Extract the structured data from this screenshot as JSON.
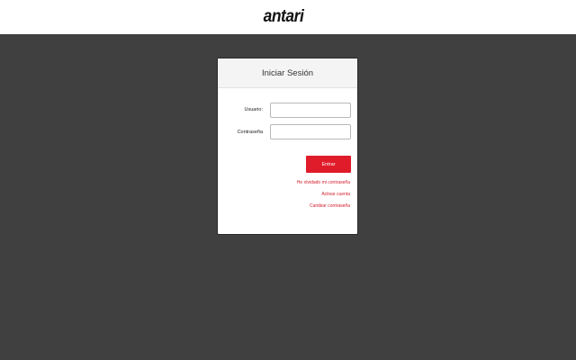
{
  "header": {
    "logo_text": "antari"
  },
  "login": {
    "title": "Iniciar Sesión",
    "username_label": "Usuario:",
    "username_value": "",
    "password_label": "Contraseña",
    "password_value": "",
    "submit_label": "Entrar",
    "links": {
      "forgot_password": "He olvidado mi contraseña",
      "activate_account": "Activar cuenta",
      "change_password": "Cambiar contraseña"
    }
  },
  "colors": {
    "background": "#404040",
    "accent": "#e01b2a",
    "link": "#d3202f"
  }
}
